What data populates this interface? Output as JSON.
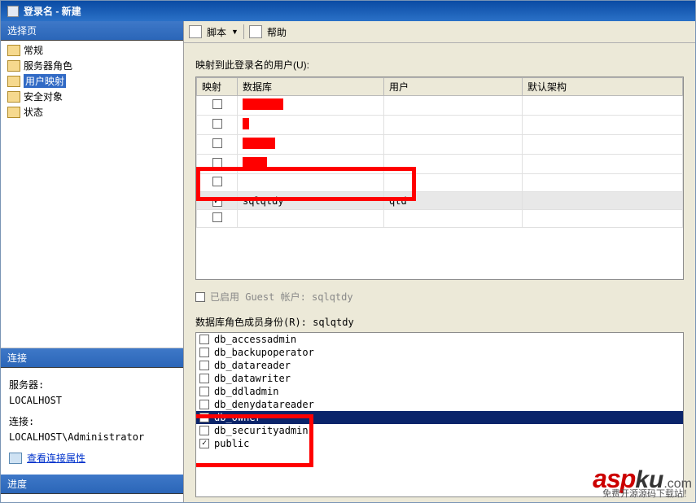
{
  "title": "登录名 - 新建",
  "left": {
    "select_header": "选择页",
    "nav": [
      {
        "label": "常规",
        "selected": false
      },
      {
        "label": "服务器角色",
        "selected": false
      },
      {
        "label": "用户映射",
        "selected": true
      },
      {
        "label": "安全对象",
        "selected": false
      },
      {
        "label": "状态",
        "selected": false
      }
    ],
    "conn_header": "连接",
    "server_label": "服务器:",
    "server_value": "LOCALHOST",
    "conn_label": "连接:",
    "conn_value": "LOCALHOST\\Administrator",
    "view_props": "查看连接属性",
    "progress_header": "进度"
  },
  "toolbar": {
    "script": "脚本",
    "help": "帮助"
  },
  "main": {
    "mapping_label": "映射到此登录名的用户(U):",
    "columns": {
      "map": "映射",
      "db": "数据库",
      "user": "用户",
      "schema": "默认架构"
    },
    "rows": [
      {
        "checked": false,
        "db_redwidth": 50,
        "user": "",
        "schema": ""
      },
      {
        "checked": false,
        "db_redwidth": 8,
        "user": "",
        "schema": ""
      },
      {
        "checked": false,
        "db_redwidth": 40,
        "user": "",
        "schema": ""
      },
      {
        "checked": false,
        "db_redwidth": 30,
        "user": "",
        "schema": ""
      },
      {
        "checked": false,
        "db_text": "",
        "user": "",
        "schema": ""
      },
      {
        "checked": true,
        "db_text": "sqlqtdy",
        "user": "qtd",
        "schema": "",
        "highlight": true,
        "selected": true
      },
      {
        "checked": false,
        "db_text": "",
        "user": "",
        "schema": ""
      }
    ],
    "guest_label": "已启用 Guest 帐户: sqlqtdy",
    "guest_enabled": false,
    "roles_label": "数据库角色成员身份(R): sqlqtdy",
    "roles": [
      {
        "name": "db_accessadmin",
        "checked": false
      },
      {
        "name": "db_backupoperator",
        "checked": false
      },
      {
        "name": "db_datareader",
        "checked": false
      },
      {
        "name": "db_datawriter",
        "checked": false
      },
      {
        "name": "db_ddladmin",
        "checked": false
      },
      {
        "name": "db_denydatareader",
        "checked": false
      },
      {
        "name": "db_owner",
        "checked": true,
        "selected": true
      },
      {
        "name": "db_securityadmin",
        "checked": false
      },
      {
        "name": "public",
        "checked": true
      }
    ]
  },
  "watermark": {
    "brand1": "asp",
    "brand2": "ku",
    "dotcom": ".com",
    "sub": "免费开源源码下载站！"
  }
}
